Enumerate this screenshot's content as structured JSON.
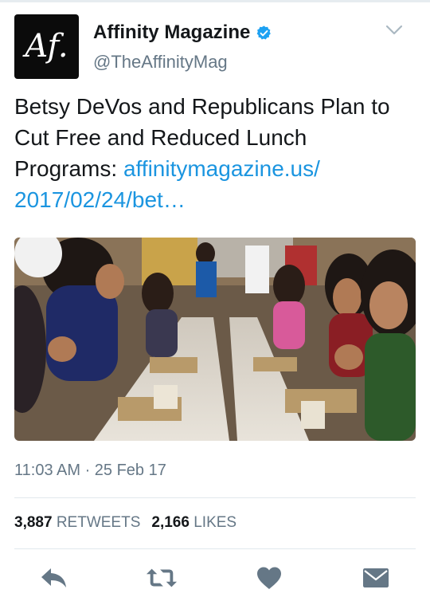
{
  "tweet": {
    "avatar_text": "Af.",
    "display_name": "Affinity Magazine",
    "handle": "@TheAffinityMag",
    "text": "Betsy DeVos and Republicans Plan to Cut Free and Reduced Lunch Programs: ",
    "link_text": "affinitymagazine.us/ 2017/02/24/bet…",
    "timestamp": "11:03 AM · 25 Feb 17"
  },
  "stats": {
    "retweets_count": "3,887",
    "retweets_label": "RETWEETS",
    "likes_count": "2,166",
    "likes_label": "LIKES"
  },
  "icons": {
    "verified": "verified-badge-icon",
    "menu": "chevron-down-icon",
    "reply": "reply-icon",
    "retweet": "retweet-icon",
    "like": "heart-icon",
    "message": "envelope-icon"
  },
  "colors": {
    "link": "#1b95e0",
    "verified": "#1da1f2",
    "muted_text": "#657786",
    "action_icon": "#657786"
  }
}
